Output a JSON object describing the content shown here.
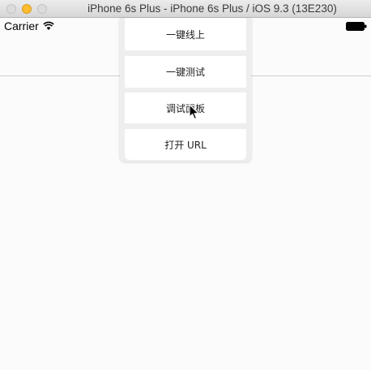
{
  "window": {
    "title": "iPhone 6s Plus - iPhone 6s Plus / iOS 9.3 (13E230)"
  },
  "status_bar": {
    "carrier": "Carrier"
  },
  "menu": {
    "items": [
      {
        "label": "一键线上"
      },
      {
        "label": "一键测试"
      },
      {
        "label": "调试面板"
      },
      {
        "label": "打开 URL"
      }
    ]
  },
  "icons": [
    "wifi-icon",
    "battery-icon",
    "mouse-cursor-icon"
  ]
}
